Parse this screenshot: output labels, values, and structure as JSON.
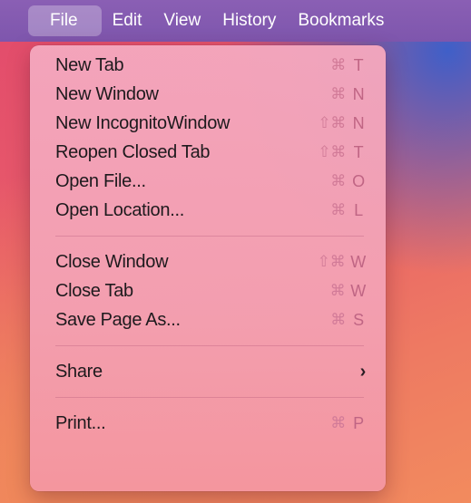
{
  "menubar": {
    "items": [
      "File",
      "Edit",
      "View",
      "History",
      "Bookmarks"
    ]
  },
  "file_menu": {
    "group1": [
      {
        "label": "New Tab",
        "mods": "⌘",
        "key": "T"
      },
      {
        "label": "New Window",
        "mods": "⌘",
        "key": "N"
      },
      {
        "label": "New IncognitoWindow",
        "mods": "⇧⌘",
        "key": "N"
      },
      {
        "label": "Reopen Closed Tab",
        "mods": "⇧⌘",
        "key": "T"
      },
      {
        "label": "Open File...",
        "mods": "⌘",
        "key": "O"
      },
      {
        "label": "Open Location...",
        "mods": "⌘",
        "key": "L"
      }
    ],
    "group2": [
      {
        "label": "Close Window",
        "mods": "⇧⌘",
        "key": "W"
      },
      {
        "label": "Close Tab",
        "mods": "⌘",
        "key": "W"
      },
      {
        "label": "Save Page As...",
        "mods": "⌘",
        "key": "S"
      }
    ],
    "share": {
      "label": "Share",
      "submenu_icon": "chevron-right-icon"
    },
    "print": {
      "label": "Print...",
      "mods": "⌘",
      "key": "P"
    }
  }
}
